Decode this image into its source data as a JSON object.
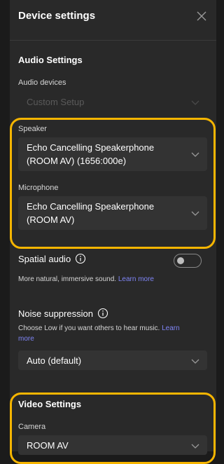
{
  "header": {
    "title": "Device settings",
    "close_label": "Close"
  },
  "audio": {
    "section_title": "Audio Settings",
    "devices_label": "Audio devices",
    "devices_value": "Custom Setup",
    "speaker_label": "Speaker",
    "speaker_value_line1": "Echo Cancelling Speakerphone",
    "speaker_value_line2": "(ROOM AV) (1656:000e)",
    "mic_label": "Microphone",
    "mic_value_line1": "Echo Cancelling Speakerphone",
    "mic_value_line2": "(ROOM AV)",
    "spatial_label": "Spatial audio",
    "spatial_desc": "More natural, immersive sound.",
    "spatial_learn_more": "Learn more",
    "spatial_enabled": false,
    "noise_label": "Noise suppression",
    "noise_desc": "Choose Low if you want others to hear music.",
    "noise_learn_more_a": "Learn",
    "noise_learn_more_b": "more",
    "noise_value": "Auto (default)"
  },
  "video": {
    "section_title": "Video Settings",
    "camera_label": "Camera",
    "camera_value": "ROOM AV"
  },
  "colors": {
    "highlight": "#f6b500",
    "accent_link": "#7f85f5",
    "panel": "#292929"
  },
  "icons": [
    "close-icon",
    "chevron-down-icon",
    "info-icon"
  ]
}
